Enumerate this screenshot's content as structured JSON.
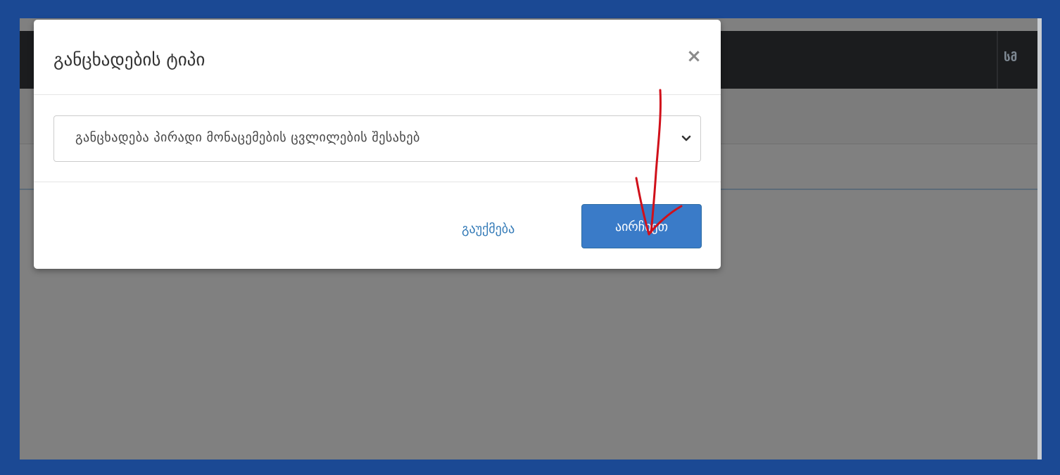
{
  "topbar": {
    "right_text": "სმ"
  },
  "modal": {
    "title": "განცხადების ტიპი",
    "close_symbol": "×",
    "select_value": "განცხადება პირადი მონაცემების ცვლილების შესახებ",
    "cancel_label": "გაუქმება",
    "primary_label": "აირჩიეთ"
  },
  "colors": {
    "frame": "#1b4994",
    "overlay": "#808080",
    "primary": "#3a7bc8",
    "link": "#337ab7",
    "annotation": "#d0101a"
  },
  "icons": {
    "close": "close-icon",
    "select_arrow": "chevron-down-icon",
    "annotation": "hand-drawn-arrow-annotation"
  }
}
